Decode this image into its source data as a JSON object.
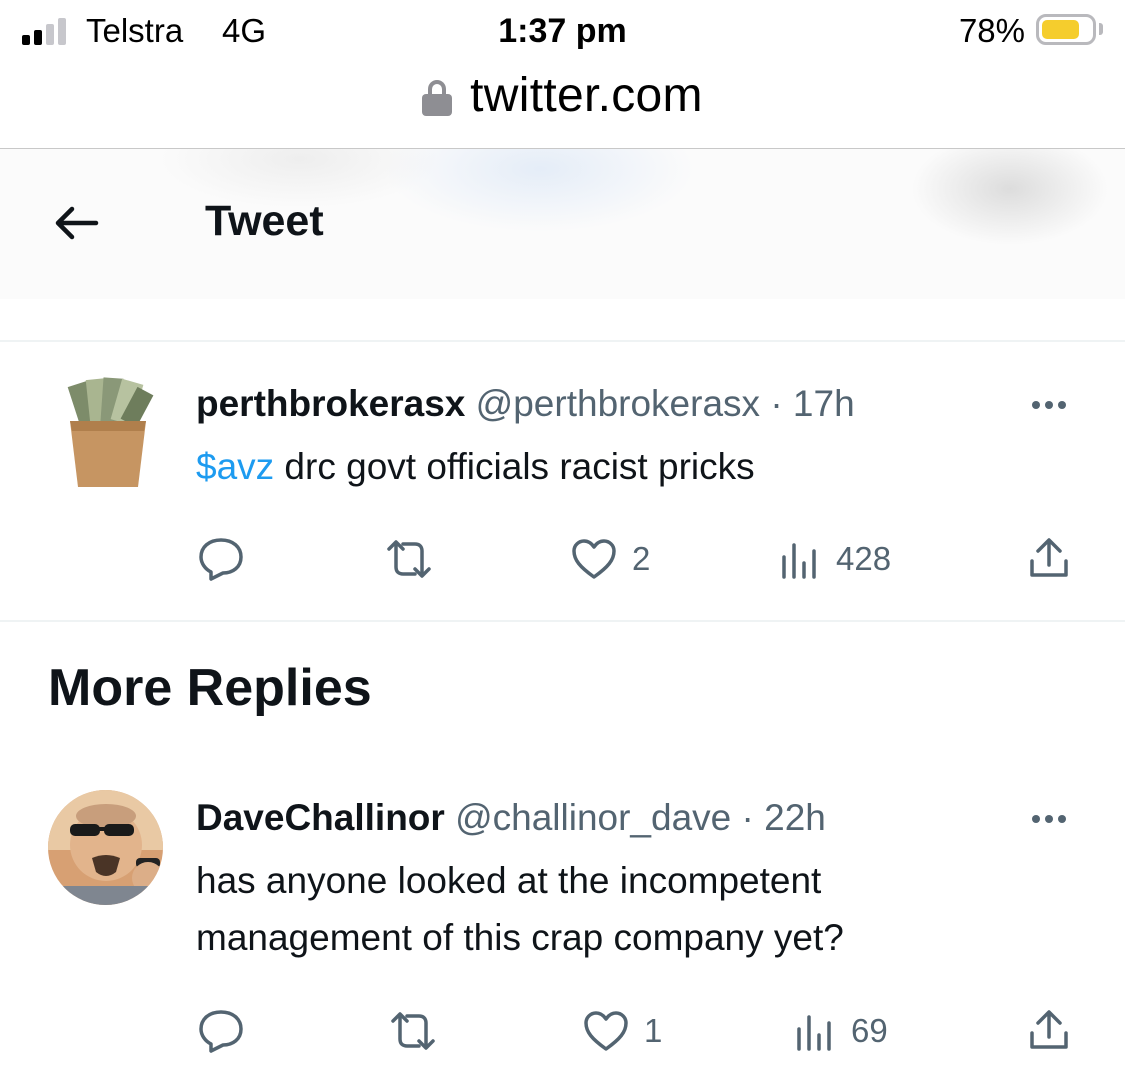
{
  "status_bar": {
    "carrier": "Telstra",
    "network": "4G",
    "time": "1:37 pm",
    "battery_percent": "78%",
    "battery_level": 0.78,
    "signal_bars": 2
  },
  "url_bar": {
    "url": "twitter.com"
  },
  "header": {
    "title": "Tweet"
  },
  "tweets": [
    {
      "display_name": "perthbrokerasx",
      "handle": "@perthbrokerasx",
      "separator": "·",
      "time_ago": "17h",
      "cashtag": "$avz",
      "text": " drc govt officials racist pricks",
      "likes": "2",
      "views": "428"
    }
  ],
  "more_replies": {
    "title": "More Replies",
    "items": [
      {
        "display_name": "DaveChallinor",
        "handle": "@challinor_dave",
        "separator": "·",
        "time_ago": "22h",
        "text_line1": "has anyone looked at the incompetent",
        "text_line2": "management of this crap company yet?",
        "likes": "1",
        "views": "69"
      }
    ]
  },
  "icons": [
    "back-arrow-icon",
    "reply-icon",
    "retweet-icon",
    "like-icon",
    "views-icon",
    "share-icon",
    "more-icon",
    "lock-icon"
  ],
  "colors": {
    "link": "#1d9bf0",
    "secondary_text": "#536471",
    "primary_text": "#0f1419",
    "battery": "#f5cd2d"
  }
}
